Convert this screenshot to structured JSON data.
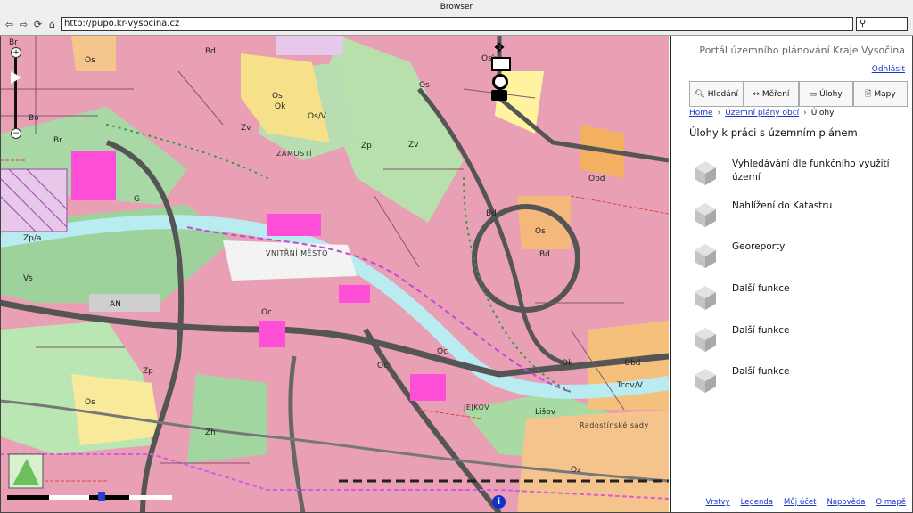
{
  "window": {
    "title": "Browser"
  },
  "toolbar": {
    "url": "http://pupo.kr-vysocina.cz"
  },
  "icons": {
    "back": "back-arrow-icon",
    "forward": "forward-arrow-icon",
    "reload": "reload-icon",
    "home": "home-icon",
    "search": "search-icon",
    "cube": "cube-icon"
  },
  "map": {
    "labels": [
      "Br",
      "Os",
      "Bd",
      "Ok",
      "Zp",
      "Zv",
      "G",
      "Vs",
      "AN",
      "Oc",
      "Obd",
      "Tcov/V",
      "Zh",
      "Oz",
      "ZÁMOSTÍ",
      "VNITŘNÍ MĚSTO",
      "JEJKOV",
      "Radostínské sady",
      "Os/V",
      "Zp/a",
      "Lišov"
    ],
    "overlay_icons": [
      "fullscreen-icon",
      "picture-icon",
      "target-icon",
      "camera-icon",
      "info-icon",
      "zoom-in-icon",
      "zoom-out-icon"
    ]
  },
  "panel": {
    "title": "Portál územního plánování Kraje Vysočina",
    "logout": "Odhlásit",
    "buttons": [
      {
        "label": "Hledání",
        "icon": "magnifier-icon"
      },
      {
        "label": "Měření",
        "icon": "measure-icon"
      },
      {
        "label": "Úlohy",
        "icon": "monitor-icon"
      },
      {
        "label": "Mapy",
        "icon": "page-icon"
      }
    ],
    "breadcrumb": [
      "Home",
      "Územní plány obcí",
      "Úlohy"
    ],
    "heading": "Úlohy k práci s územním plánem",
    "tasks": [
      "Vyhledávání dle funkčního využití území",
      "Nahlížení do Katastru",
      "Georeporty",
      "Další funkce",
      "Další funkce",
      "Další funkce"
    ],
    "footer": [
      "Vrstvy",
      "Legenda",
      "Můj účet",
      "Nápověda",
      "O mapě"
    ]
  }
}
